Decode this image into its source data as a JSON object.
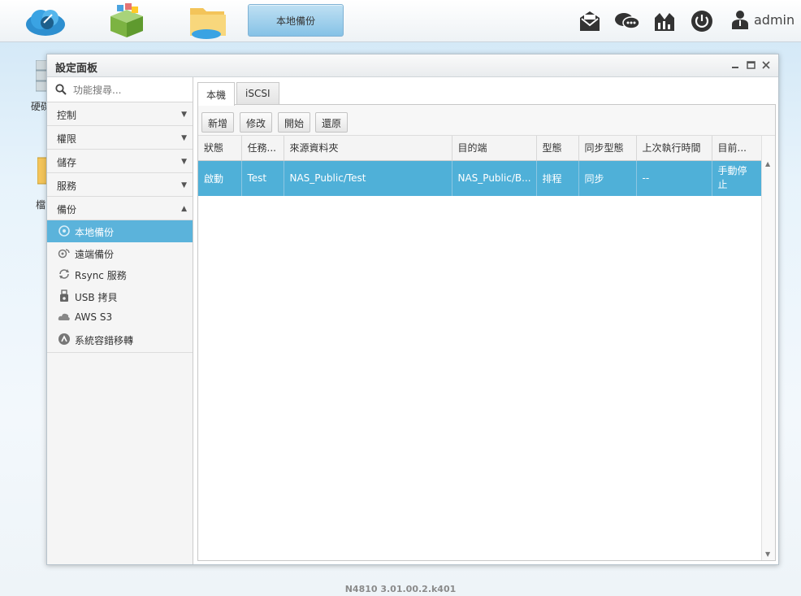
{
  "taskbar": {
    "active_task": "本地備份",
    "user": "admin",
    "icons": [
      "cloud-icon",
      "app-store-icon",
      "file-manager-icon",
      "mail-icon",
      "chat-icon",
      "monitor-icon",
      "power-icon",
      "user-icon"
    ]
  },
  "desktop": {
    "icon1_label": "硬碟",
    "icon2_label": "檔"
  },
  "window": {
    "title": "設定面板"
  },
  "sidebar": {
    "search_placeholder": "功能搜尋...",
    "categories": [
      {
        "label": "控制",
        "arrow": "▼"
      },
      {
        "label": "權限",
        "arrow": "▼"
      },
      {
        "label": "儲存",
        "arrow": "▼"
      },
      {
        "label": "服務",
        "arrow": "▼"
      },
      {
        "label": "備份",
        "arrow": "▲"
      }
    ],
    "backup_items": [
      {
        "label": "本地備份",
        "icon": "local-backup-icon"
      },
      {
        "label": "遠端備份",
        "icon": "remote-backup-icon"
      },
      {
        "label": "Rsync 服務",
        "icon": "rsync-icon"
      },
      {
        "label": "USB 拷貝",
        "icon": "usb-icon"
      },
      {
        "label": "AWS S3",
        "icon": "cloud-icon"
      },
      {
        "label": "系統容錯移轉",
        "icon": "failover-icon"
      }
    ]
  },
  "tabs": [
    "本機",
    "iSCSI"
  ],
  "toolbar": {
    "add": "新增",
    "edit": "修改",
    "start": "開始",
    "restore": "還原"
  },
  "table": {
    "headers": [
      "狀態",
      "任務...",
      "來源資料夾",
      "目的端",
      "型態",
      "同步型態",
      "上次執行時間",
      "目前..."
    ],
    "rows": [
      [
        "啟動",
        "Test",
        "NAS_Public/Test",
        "NAS_Public/B...",
        "排程",
        "同步",
        "--",
        "手動停止"
      ]
    ]
  },
  "footer": "N4810   3.01.00.2.k401"
}
